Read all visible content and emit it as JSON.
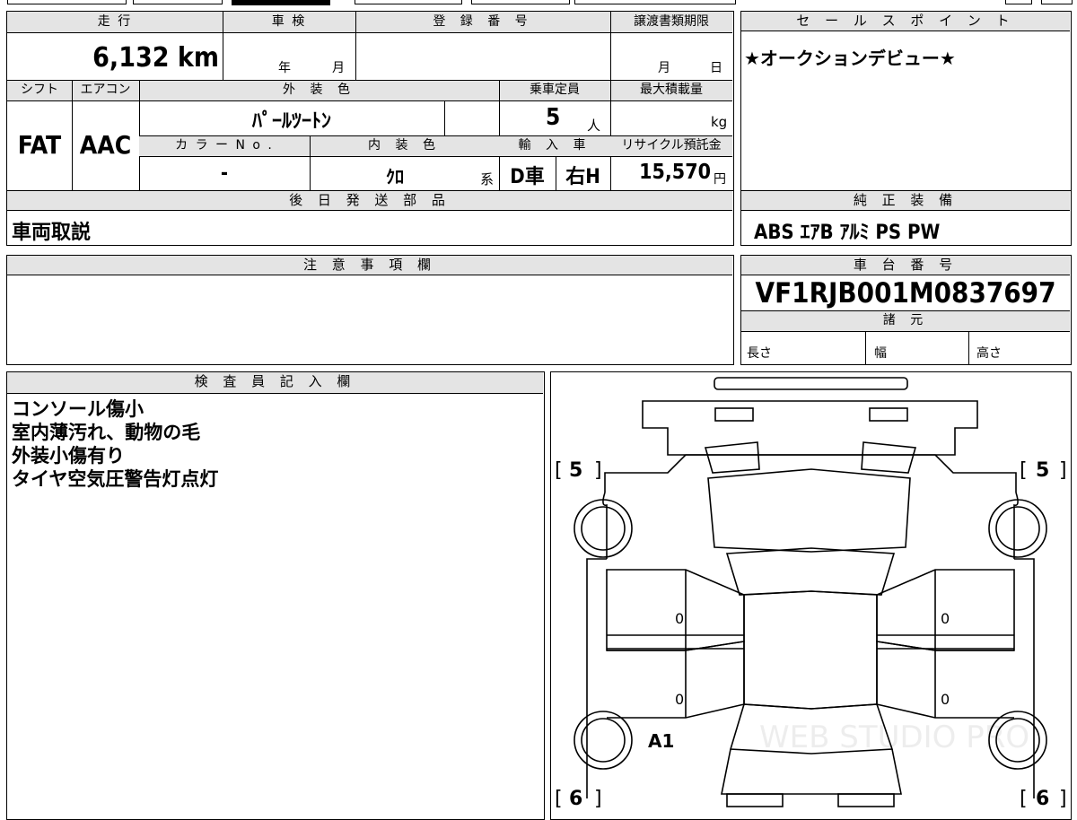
{
  "top_table": {
    "mileage_header": "走 行",
    "mileage_value": "6,132 km",
    "inspection_header": "車 検",
    "inspection_year_unit": "年",
    "inspection_month_unit": "月",
    "registration_header": "登 録 番 号",
    "registration_value": "",
    "transfer_doc_header": "譲渡書類期限",
    "transfer_month_unit": "月",
    "transfer_day_unit": "日",
    "shift_header": "シフト",
    "shift_value": "FAT",
    "aircon_header": "エアコン",
    "aircon_value": "AAC",
    "exterior_color_header": "外 装 色",
    "exterior_color_value": "ﾊﾟｰﾙﾂｰﾄﾝ",
    "capacity_header": "乗車定員",
    "capacity_value": "5",
    "capacity_unit": "人",
    "max_load_header": "最大積載量",
    "max_load_unit": "kg",
    "color_no_header": "カ ラ ー N o .",
    "color_no_value": "-",
    "interior_color_header": "内 装 色",
    "interior_color_value": "ｸﾛ",
    "interior_color_suffix": "系",
    "import_header": "輸 入 車",
    "import_value": "D車",
    "handle_value": "右H",
    "recycle_header": "リサイクル預託金",
    "recycle_value": "15,570",
    "recycle_unit": "円"
  },
  "sales_points": {
    "header": "セ ー ル ス ポ イ ン ト",
    "text": "★オークションデビュー★"
  },
  "later_shipping": {
    "header": "後 日 発 送 部 品",
    "text": "車両取説"
  },
  "genuine_equipment": {
    "header": "純 正 装 備",
    "text": "ABS ｴｱB ｱﾙﾐ PS PW"
  },
  "notes": {
    "header": "注 意 事 項 欄",
    "text": ""
  },
  "chassis": {
    "header": "車 台 番 号",
    "value": "VF1RJB001M0837697",
    "specs_header": "諸 元",
    "length_label": "長さ",
    "width_label": "幅",
    "height_label": "高さ"
  },
  "inspector": {
    "header": "検 査 員 記 入 欄",
    "lines": [
      "コンソール傷小",
      "室内薄汚れ、動物の毛",
      "外装小傷有り",
      "タイヤ空気圧警告灯点灯"
    ]
  },
  "diagram": {
    "tire_front_left": "5",
    "tire_front_right": "5",
    "tire_rear_left": "6",
    "tire_rear_right": "6",
    "bracket_left": "[",
    "bracket_right": "]",
    "door_mark_fl": "0",
    "door_mark_rl": "0",
    "door_mark_fr": "0",
    "door_mark_rr": "0",
    "damage_code": "A1",
    "watermark": "WEB STUDIO PRO"
  }
}
